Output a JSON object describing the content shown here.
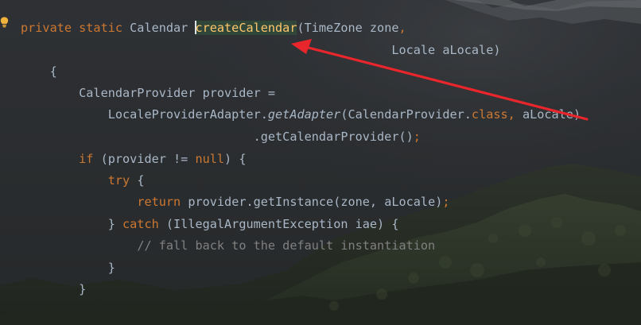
{
  "editor": {
    "lines": [
      {
        "id": "l1",
        "tokens": [
          {
            "cls": "kw",
            "t": "private static "
          },
          {
            "cls": "ty",
            "t": "Calendar "
          },
          {
            "cls": "caret",
            "t": ""
          },
          {
            "cls": "sel",
            "t": "createCalendar"
          },
          {
            "cls": "pn",
            "t": "(TimeZone zone"
          },
          {
            "cls": "kw",
            "t": ","
          }
        ]
      },
      {
        "id": "l2",
        "tokens": [
          {
            "cls": "pn",
            "t": "                                                   Locale aLocale)"
          }
        ]
      },
      {
        "id": "l3",
        "tokens": [
          {
            "cls": "pn",
            "t": "    {"
          }
        ]
      },
      {
        "id": "l4",
        "tokens": [
          {
            "cls": "pn",
            "t": "        CalendarProvider provider ="
          }
        ]
      },
      {
        "id": "l5",
        "tokens": [
          {
            "cls": "pn",
            "t": "            LocaleProviderAdapter."
          },
          {
            "cls": "it",
            "t": "getAdapter"
          },
          {
            "cls": "pn",
            "t": "(CalendarProvider."
          },
          {
            "cls": "kw",
            "t": "class, "
          },
          {
            "cls": "pn",
            "t": "aLocale)"
          }
        ]
      },
      {
        "id": "l6",
        "tokens": [
          {
            "cls": "pn",
            "t": "                                .getCalendarProvider()"
          },
          {
            "cls": "kw",
            "t": ";"
          }
        ]
      },
      {
        "id": "l7",
        "tokens": [
          {
            "cls": "pn",
            "t": "        "
          },
          {
            "cls": "kw",
            "t": "if "
          },
          {
            "cls": "pn",
            "t": "(provider != "
          },
          {
            "cls": "kw",
            "t": "null"
          },
          {
            "cls": "pn",
            "t": ") {"
          }
        ]
      },
      {
        "id": "l8",
        "tokens": [
          {
            "cls": "pn",
            "t": "            "
          },
          {
            "cls": "kw",
            "t": "try "
          },
          {
            "cls": "pn",
            "t": "{"
          }
        ]
      },
      {
        "id": "l9",
        "tokens": [
          {
            "cls": "pn",
            "t": "                "
          },
          {
            "cls": "kw",
            "t": "return "
          },
          {
            "cls": "pn",
            "t": "provider.getInstance(zone, aLocale)"
          },
          {
            "cls": "kw",
            "t": ";"
          }
        ]
      },
      {
        "id": "l10",
        "tokens": [
          {
            "cls": "pn",
            "t": "            } "
          },
          {
            "cls": "kw",
            "t": "catch "
          },
          {
            "cls": "pn",
            "t": "(IllegalArgumentException iae) {"
          }
        ]
      },
      {
        "id": "l11",
        "tokens": [
          {
            "cls": "pn",
            "t": "                "
          },
          {
            "cls": "cm",
            "t": "// fall back to the default instantiation"
          }
        ]
      },
      {
        "id": "l12",
        "tokens": [
          {
            "cls": "pn",
            "t": "            }"
          }
        ]
      },
      {
        "id": "l13",
        "tokens": [
          {
            "cls": "pn",
            "t": "        }"
          }
        ]
      }
    ]
  },
  "annotation": {
    "arrow_color": "#e8262b"
  },
  "icons": {
    "gutter": "lightbulb-icon"
  }
}
